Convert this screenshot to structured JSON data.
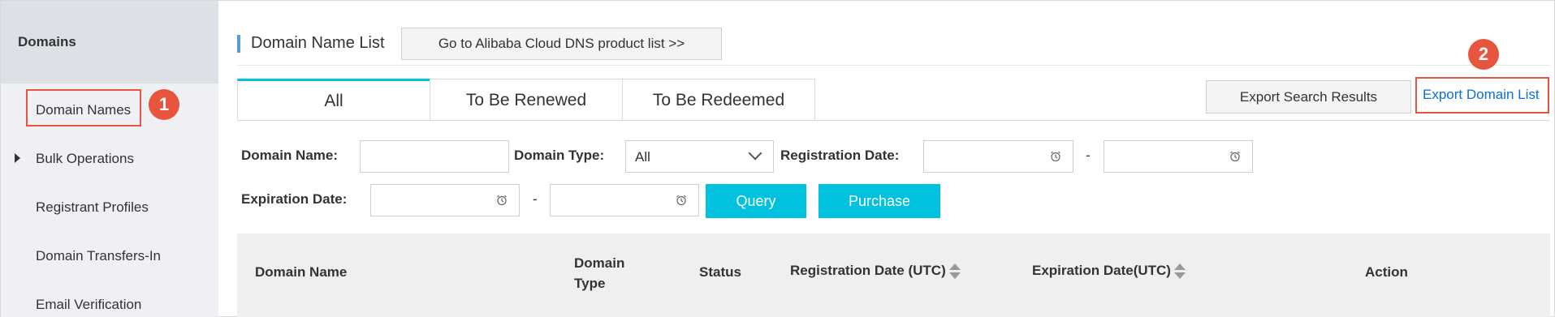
{
  "sidebar": {
    "header": "Domains",
    "items": [
      {
        "label": "Domain Names"
      },
      {
        "label": "Bulk Operations"
      },
      {
        "label": "Registrant Profiles"
      },
      {
        "label": "Domain Transfers-In"
      },
      {
        "label": "Email Verification"
      }
    ]
  },
  "annotations": {
    "step1": "1",
    "step2": "2",
    "highlight_color": "#e8553f"
  },
  "header": {
    "title": "Domain Name List",
    "dns_button": "Go to Alibaba Cloud DNS product list >>"
  },
  "tabs": [
    {
      "label": "All",
      "active": true
    },
    {
      "label": "To Be Renewed"
    },
    {
      "label": "To Be Redeemed"
    }
  ],
  "actions": {
    "export_search": "Export Search Results",
    "export_domain_list": "Export Domain List"
  },
  "filters": {
    "domain_name_label": "Domain Name:",
    "domain_name_value": "",
    "domain_type_label": "Domain Type:",
    "domain_type_value": "All",
    "registration_date_label": "Registration Date:",
    "expiration_date_label": "Expiration Date:",
    "range_separator": "-",
    "query_button": "Query",
    "purchase_button": "Purchase"
  },
  "table": {
    "columns": [
      "Domain Name",
      "Domain Type",
      "Status",
      "Registration Date (UTC)",
      "Expiration Date(UTC)",
      "Action"
    ]
  },
  "colors": {
    "accent": "#00c1de",
    "link": "#0b6fd3"
  }
}
